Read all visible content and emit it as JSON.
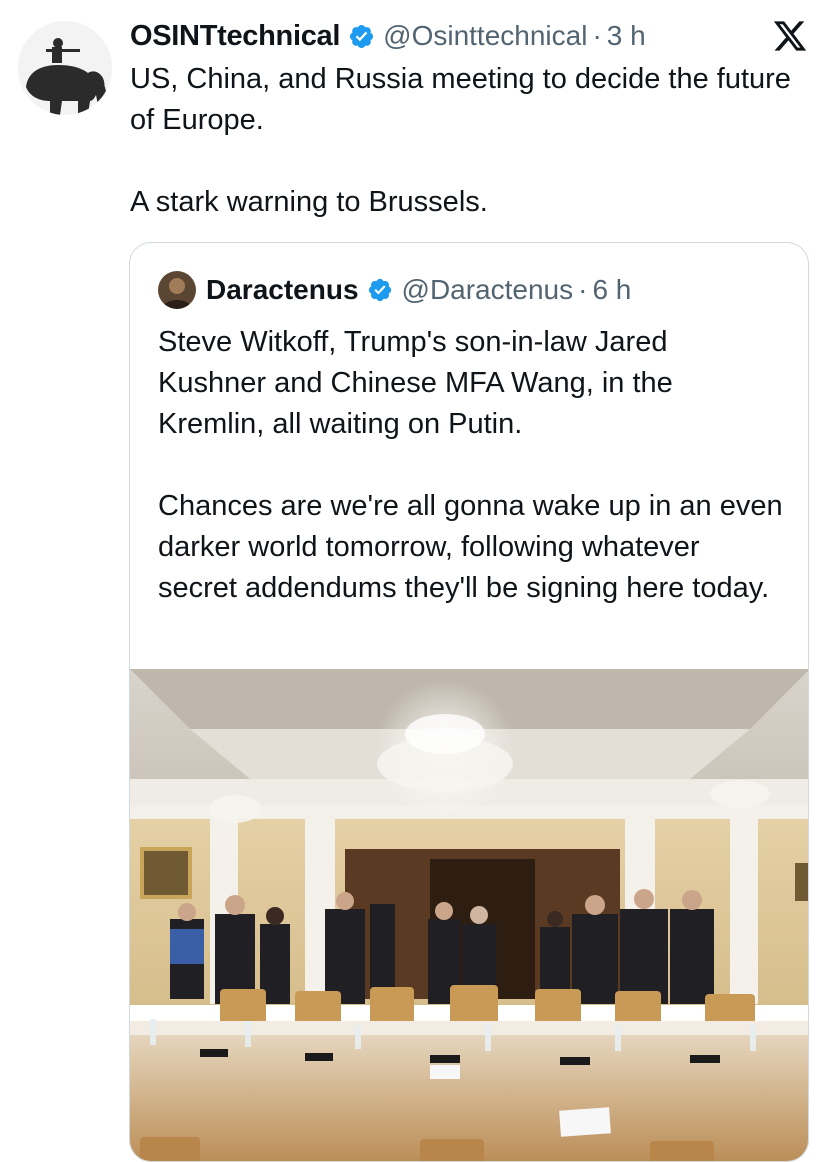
{
  "tweet": {
    "author_name": "OSINTtechnical",
    "handle": "@Osinttechnical",
    "separator": "·",
    "time": "3 h",
    "paragraphs": [
      "US, China, and Russia meeting to decide the future of Europe.",
      "A stark warning to Brussels."
    ],
    "avatar_icon": "soldier-on-elephant-avatar",
    "verified_icon": "verified-badge-icon",
    "platform_icon": "x-logo-icon"
  },
  "quoted_tweet": {
    "author_name": "Daractenus",
    "handle": "@Daractenus",
    "separator": "·",
    "time": "6 h",
    "paragraphs": [
      "Steve Witkoff, Trump's son-in-law Jared Kushner and Chinese MFA Wang, in the Kremlin, all waiting on Putin.",
      "Chances are we're all gonna wake up in an even darker world tomorrow, following whatever secret addendums they'll be signing here today."
    ],
    "media": "photo-ornate-meeting-room-with-chandeliers-and-long-table"
  },
  "colors": {
    "text_primary": "#0f1419",
    "text_secondary": "#536471",
    "verified_blue": "#1d9bf0",
    "border": "#cfd9de"
  }
}
